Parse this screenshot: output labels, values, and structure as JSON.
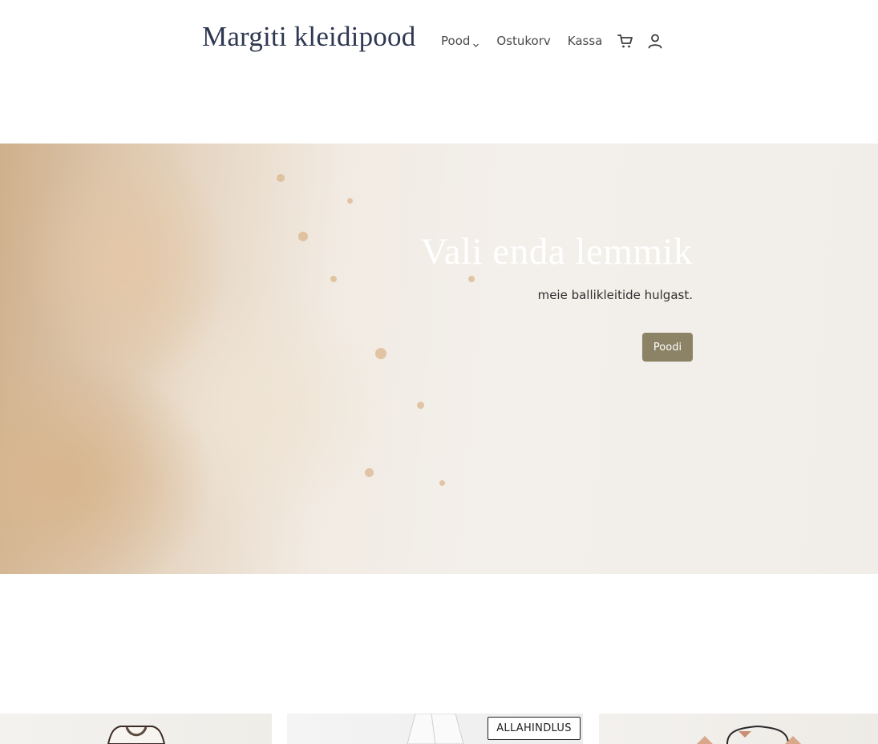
{
  "header": {
    "logo": "Margiti kleidipood",
    "nav": {
      "pood": "Pood",
      "ostukorv": "Ostukorv",
      "kassa": "Kassa"
    },
    "icons": [
      "chevron-down-icon",
      "cart-icon",
      "user-icon"
    ]
  },
  "hero": {
    "title": "Vali enda lemmik",
    "subtitle": "meie ballikleitide hulgast.",
    "button_label": "Poodi",
    "button_color": "#8c8266"
  },
  "products": {
    "badge": "ALLAHINDLUS"
  },
  "colors": {
    "logo": "#2f3852",
    "text": "#4a4a4a",
    "hero_title": "#ffffff"
  }
}
